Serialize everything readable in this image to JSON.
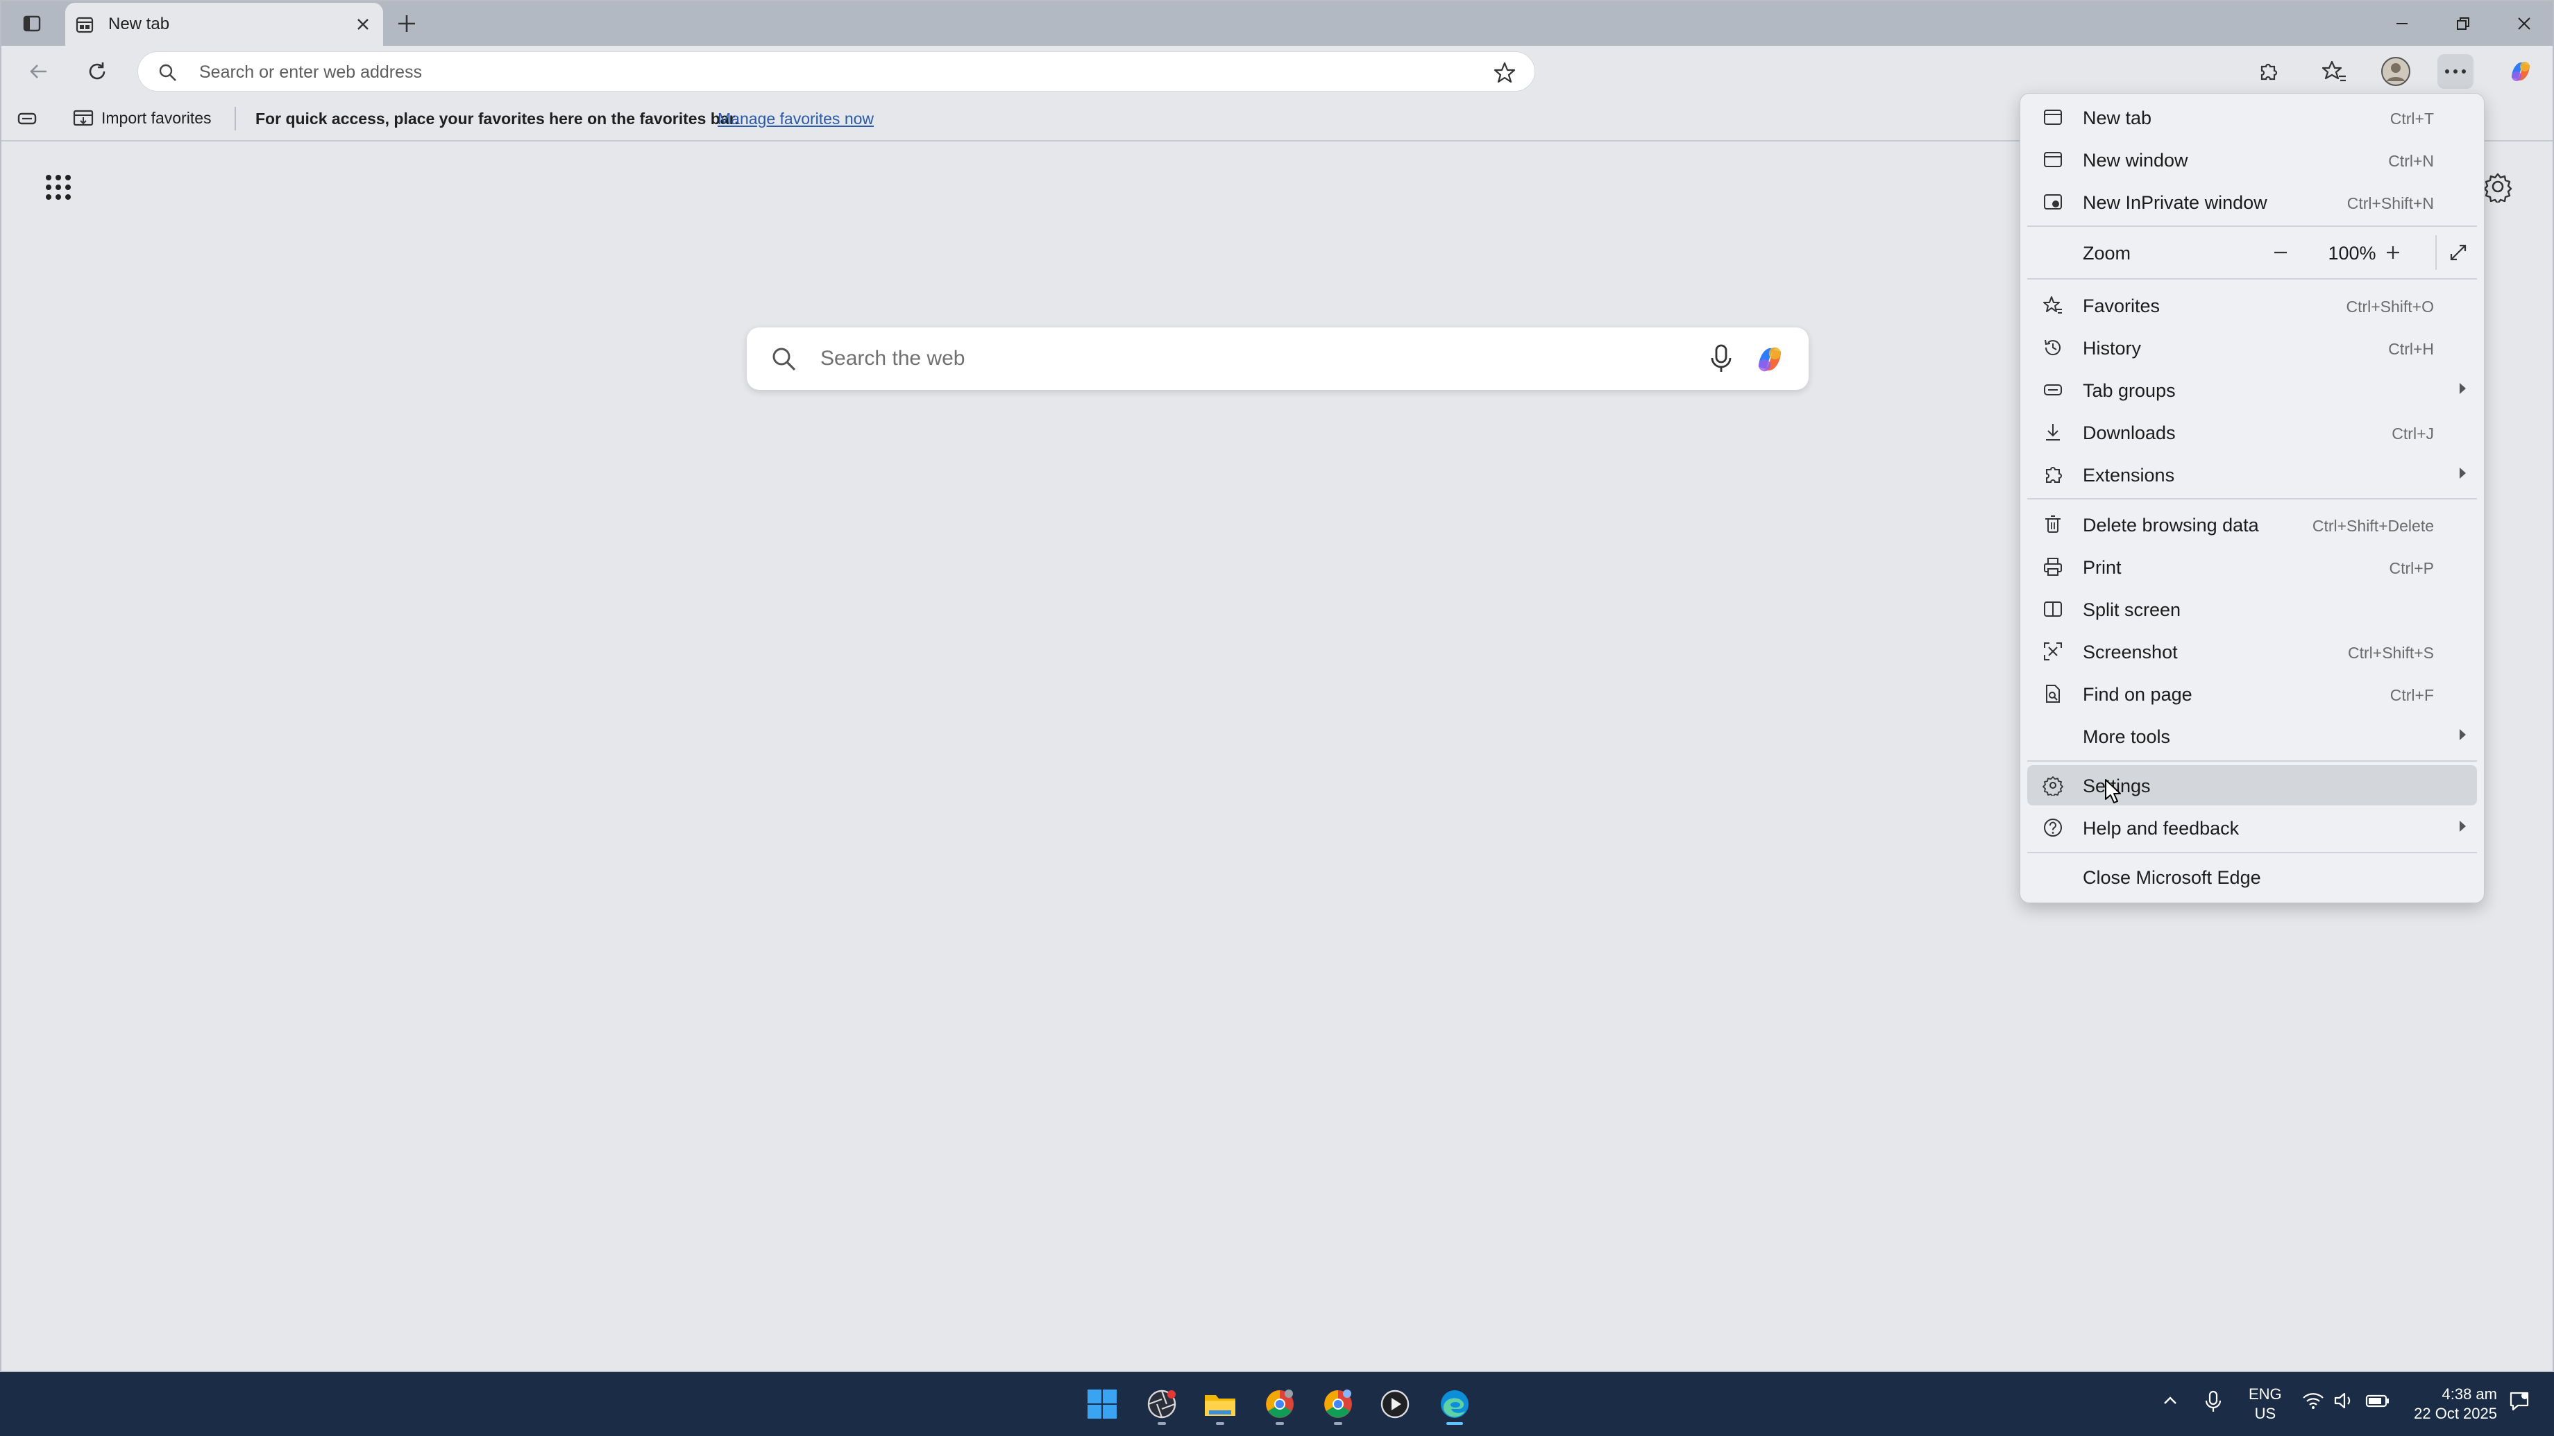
{
  "browser": {
    "tab": {
      "title": "New tab"
    },
    "address_bar": {
      "placeholder": "Search or enter web address"
    }
  },
  "favorites_bar": {
    "import_label": "Import favorites",
    "message": "For quick access, place your favorites here on the favorites bar.",
    "link": "Manage favorites now"
  },
  "new_tab_page": {
    "search_placeholder": "Search the web"
  },
  "menu": {
    "new_tab": {
      "label": "New tab",
      "shortcut": "Ctrl+T"
    },
    "new_window": {
      "label": "New window",
      "shortcut": "Ctrl+N"
    },
    "inprivate": {
      "label": "New InPrivate window",
      "shortcut": "Ctrl+Shift+N"
    },
    "zoom": {
      "label": "Zoom",
      "value": "100%"
    },
    "favorites": {
      "label": "Favorites",
      "shortcut": "Ctrl+Shift+O"
    },
    "history": {
      "label": "History",
      "shortcut": "Ctrl+H"
    },
    "tab_groups": {
      "label": "Tab groups"
    },
    "downloads": {
      "label": "Downloads",
      "shortcut": "Ctrl+J"
    },
    "extensions": {
      "label": "Extensions"
    },
    "delete_data": {
      "label": "Delete browsing data",
      "shortcut": "Ctrl+Shift+Delete"
    },
    "print": {
      "label": "Print",
      "shortcut": "Ctrl+P"
    },
    "split_screen": {
      "label": "Split screen"
    },
    "screenshot": {
      "label": "Screenshot",
      "shortcut": "Ctrl+Shift+S"
    },
    "find": {
      "label": "Find on page",
      "shortcut": "Ctrl+F"
    },
    "more_tools": {
      "label": "More tools"
    },
    "settings": {
      "label": "Settings"
    },
    "help": {
      "label": "Help and feedback"
    },
    "close": {
      "label": "Close Microsoft Edge"
    }
  },
  "taskbar": {
    "language": {
      "line1": "ENG",
      "line2": "US"
    },
    "clock": {
      "time": "4:38 am",
      "date": "22 Oct 2025"
    }
  },
  "colors": {
    "accent_link": "#2a5aa8",
    "taskbar": "#1b2c46",
    "windows_logo": "#3ba4f2"
  }
}
